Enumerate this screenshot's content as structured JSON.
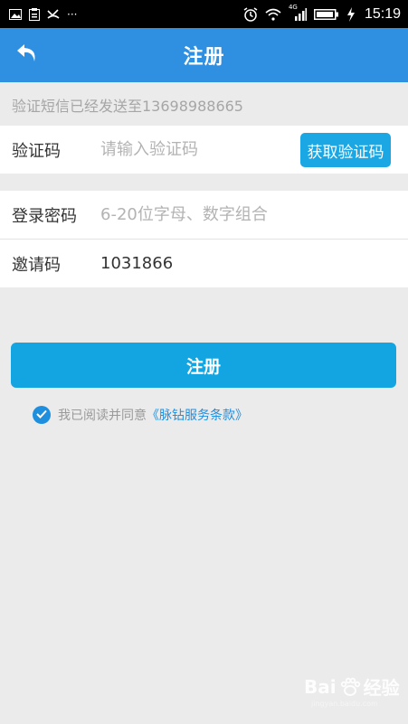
{
  "status_bar": {
    "left_icons": [
      "image-icon",
      "clipboard-icon",
      "missed-call-icon",
      "more-dots-icon"
    ],
    "overflow": "···",
    "signal_label": "4G",
    "time": "15:19"
  },
  "header": {
    "title": "注册",
    "back_icon": "back-arrow-icon"
  },
  "notice": "验证短信已经发送至13698988665",
  "form": {
    "code": {
      "label": "验证码",
      "placeholder": "请输入验证码",
      "button_label": "获取验证码"
    },
    "password": {
      "label": "登录密码",
      "placeholder": "6-20位字母、数字组合"
    },
    "invite": {
      "label": "邀请码",
      "value": "1031866"
    }
  },
  "submit_label": "注册",
  "agreement": {
    "checked": true,
    "text": "我已阅读并同意",
    "link": "《脉钻服务条款》"
  },
  "watermark": {
    "brand_left": "Bai",
    "brand_right": "经验",
    "small": "jingyan.baidu.com"
  },
  "colors": {
    "primary": "#2f8fe0",
    "button": "#12a5e2",
    "background": "#ebebeb"
  }
}
